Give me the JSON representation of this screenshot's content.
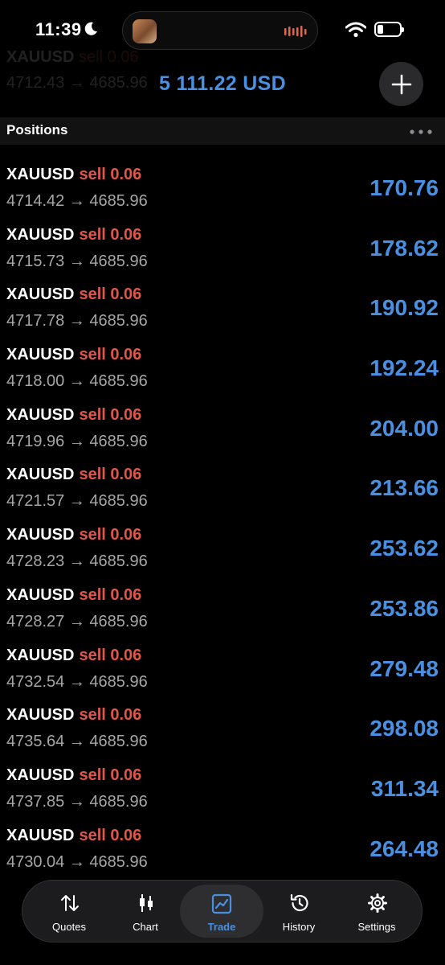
{
  "status_bar": {
    "time": "11:39"
  },
  "header": {
    "balance": "5 111.22 USD",
    "section_title": "Positions",
    "ghost_rows": [
      {
        "symbol": "XAUUSD",
        "side": "sell 0.06",
        "prices": "4712.43 → 4685.96"
      }
    ]
  },
  "positions": [
    {
      "symbol": "XAUUSD",
      "side": "sell 0.06",
      "open": "4714.42",
      "current": "4685.96",
      "profit": "170.76"
    },
    {
      "symbol": "XAUUSD",
      "side": "sell 0.06",
      "open": "4715.73",
      "current": "4685.96",
      "profit": "178.62"
    },
    {
      "symbol": "XAUUSD",
      "side": "sell 0.06",
      "open": "4717.78",
      "current": "4685.96",
      "profit": "190.92"
    },
    {
      "symbol": "XAUUSD",
      "side": "sell 0.06",
      "open": "4718.00",
      "current": "4685.96",
      "profit": "192.24"
    },
    {
      "symbol": "XAUUSD",
      "side": "sell 0.06",
      "open": "4719.96",
      "current": "4685.96",
      "profit": "204.00"
    },
    {
      "symbol": "XAUUSD",
      "side": "sell 0.06",
      "open": "4721.57",
      "current": "4685.96",
      "profit": "213.66"
    },
    {
      "symbol": "XAUUSD",
      "side": "sell 0.06",
      "open": "4728.23",
      "current": "4685.96",
      "profit": "253.62"
    },
    {
      "symbol": "XAUUSD",
      "side": "sell 0.06",
      "open": "4728.27",
      "current": "4685.96",
      "profit": "253.86"
    },
    {
      "symbol": "XAUUSD",
      "side": "sell 0.06",
      "open": "4732.54",
      "current": "4685.96",
      "profit": "279.48"
    },
    {
      "symbol": "XAUUSD",
      "side": "sell 0.06",
      "open": "4735.64",
      "current": "4685.96",
      "profit": "298.08"
    },
    {
      "symbol": "XAUUSD",
      "side": "sell 0.06",
      "open": "4737.85",
      "current": "4685.96",
      "profit": "311.34"
    },
    {
      "symbol": "XAUUSD",
      "side": "sell 0.06",
      "open": "4730.04",
      "current": "4685.96",
      "profit": "264.48"
    }
  ],
  "tabs": [
    {
      "label": "Quotes",
      "icon": "quotes-icon",
      "active": false
    },
    {
      "label": "Chart",
      "icon": "chart-icon",
      "active": false
    },
    {
      "label": "Trade",
      "icon": "trade-icon",
      "active": true
    },
    {
      "label": "History",
      "icon": "history-icon",
      "active": false
    },
    {
      "label": "Settings",
      "icon": "settings-icon",
      "active": false
    }
  ],
  "colors": {
    "profit": "#4a90e2",
    "sell": "#e0574a",
    "background": "#000000",
    "muted": "#a6a6a6"
  }
}
